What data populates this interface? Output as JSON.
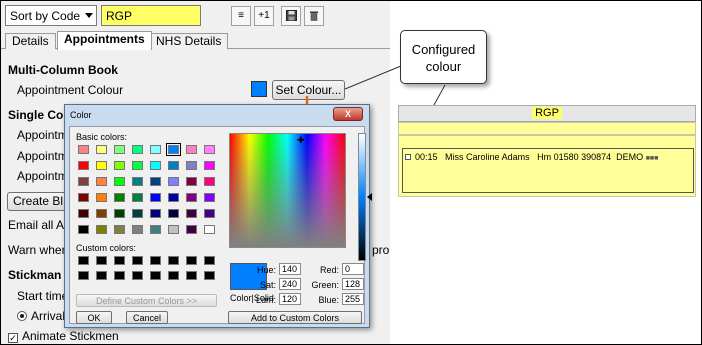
{
  "toolbar": {
    "sort_label": "Sort by Code",
    "code_value": "RGP",
    "buttons": [
      "align-icon",
      "plus-one-icon",
      "save-icon",
      "trash-icon"
    ],
    "plus_one_label": "+1"
  },
  "tabs": [
    {
      "label": "Details",
      "active": false
    },
    {
      "label": "Appointments",
      "active": true
    },
    {
      "label": "NHS Details",
      "active": false
    }
  ],
  "content": {
    "multi_heading": "Multi-Column Book",
    "appt_colour_label": "Appointment Colour",
    "set_colour_button": "Set Colour...",
    "single_heading_fragment": "Single Co",
    "appt_fragment_1": "Appointm",
    "appt_fragment_2": "Appointm",
    "appt_fragment_3": "Appointm",
    "create_button_fragment": "Create Bl",
    "email_fragment": "Email all Ap",
    "warn_fragment": "Warn when",
    "warn_right_fragment": "pro",
    "stickman_fragment": "Stickman",
    "start_time_fragment": "Start time",
    "arrival_fragment": "Arrival",
    "animate_label": "Animate Stickmen",
    "accent_colour": "#0080ff"
  },
  "dialog": {
    "title": "Color",
    "close_label": "X",
    "basic_colors_label": "Basic colors:",
    "custom_colors_label": "Custom colors:",
    "define_button": "Define Custom Colors >>",
    "ok_button": "OK",
    "cancel_button": "Cancel",
    "add_button": "Add to Custom Colors",
    "color_solid_label": "Color|Solid",
    "hue_label": "Hue:",
    "hue": "140",
    "sat_label": "Sat:",
    "sat": "240",
    "lum_label": "Lum:",
    "lum": "120",
    "red_label": "Red:",
    "red": "0",
    "green_label": "Green:",
    "green": "128",
    "blue_label": "Blue:",
    "blue": "255",
    "basic_colors": [
      "#ff8080",
      "#ffff80",
      "#80ff80",
      "#00ff80",
      "#80ffff",
      "#0080ff",
      "#ff80c0",
      "#ff80ff",
      "#ff0000",
      "#ffff00",
      "#80ff00",
      "#00ff40",
      "#00ffff",
      "#0080c0",
      "#8080c0",
      "#ff00ff",
      "#804040",
      "#ff8040",
      "#00ff00",
      "#008080",
      "#004080",
      "#8080ff",
      "#800040",
      "#ff0080",
      "#800000",
      "#ff8000",
      "#008000",
      "#008040",
      "#0000ff",
      "#0000a0",
      "#800080",
      "#8000ff",
      "#400000",
      "#804000",
      "#004000",
      "#004040",
      "#000080",
      "#000040",
      "#400040",
      "#400080",
      "#000000",
      "#808000",
      "#808040",
      "#808080",
      "#408080",
      "#c0c0c0",
      "#400040",
      "#ffffff"
    ]
  },
  "callout": {
    "line1": "Configured",
    "line2": "colour"
  },
  "preview_panel": {
    "header": "RGP",
    "time": "00:15",
    "patient": "Miss Caroline Adams",
    "phone": "Hm 01580 390874",
    "tag": "DEMO"
  }
}
